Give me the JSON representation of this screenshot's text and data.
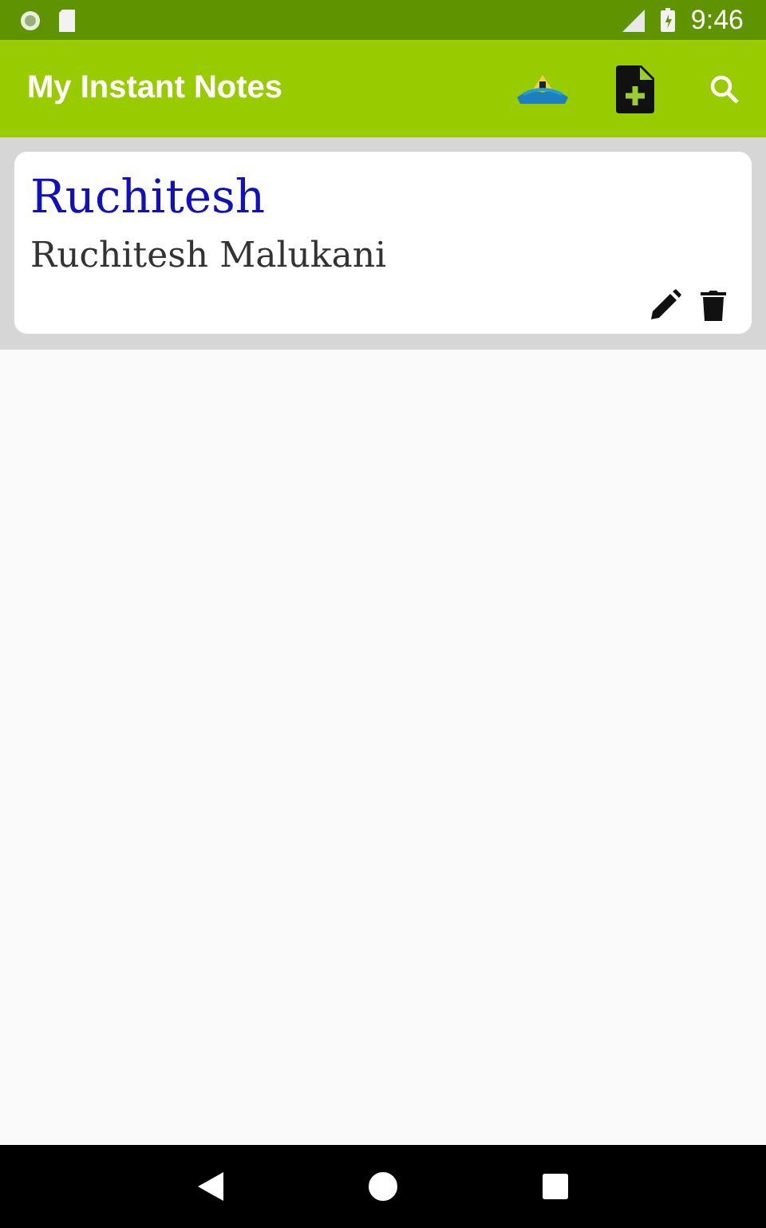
{
  "status_bar": {
    "time": "9:46"
  },
  "app_bar": {
    "title": "My Instant Notes"
  },
  "notes": [
    {
      "title": "Ruchitesh",
      "body": "Ruchitesh Malukani"
    }
  ]
}
